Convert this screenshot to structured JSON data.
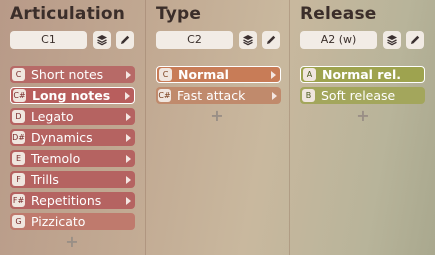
{
  "columns": [
    {
      "title": "Articulation",
      "key_field": "C1",
      "items": [
        {
          "key": "C",
          "label": "Short notes",
          "arrow": true
        },
        {
          "key": "C#",
          "label": "Long notes",
          "arrow": true,
          "selected": true
        },
        {
          "key": "D",
          "label": "Legato",
          "arrow": true
        },
        {
          "key": "D#",
          "label": "Dynamics",
          "arrow": true
        },
        {
          "key": "E",
          "label": "Tremolo",
          "arrow": true
        },
        {
          "key": "F",
          "label": "Trills",
          "arrow": true
        },
        {
          "key": "F#",
          "label": "Repetitions",
          "arrow": true
        },
        {
          "key": "G",
          "label": "Pizzicato",
          "arrow": false
        }
      ]
    },
    {
      "title": "Type",
      "key_field": "C2",
      "items": [
        {
          "key": "C",
          "label": "Normal",
          "arrow": true,
          "selected": true
        },
        {
          "key": "C#",
          "label": "Fast attack",
          "arrow": true
        }
      ]
    },
    {
      "title": "Release",
      "key_field": "A2 (w)",
      "items": [
        {
          "key": "A",
          "label": "Normal rel.",
          "arrow": false,
          "selected": true
        },
        {
          "key": "B",
          "label": "Soft release",
          "arrow": false
        }
      ]
    }
  ],
  "add_symbol": "+",
  "colors": {
    "articulation": "#b85e5d",
    "type": "#c87c57",
    "release": "#9ea34f",
    "title_text": "#3b2e2a"
  },
  "icons": {
    "layers": "layers-icon",
    "pencil": "pencil-icon"
  }
}
